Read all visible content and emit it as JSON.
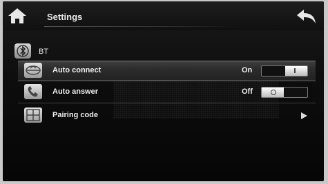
{
  "header": {
    "title": "Settings",
    "home_icon": "home-icon",
    "back_icon": "back-arrow-icon"
  },
  "section": {
    "label": "BT",
    "icon": "bluetooth-icon"
  },
  "rows": [
    {
      "label": "Auto connect",
      "value": "On",
      "icon": "auto-connect-icon",
      "toggle_on": true
    },
    {
      "label": "Auto answer",
      "value": "Off",
      "icon": "phone-answer-icon",
      "toggle_on": false
    },
    {
      "label": "Pairing code",
      "icon": "keypad-icon",
      "chevron_icon": "chevron-right-icon"
    }
  ],
  "colors": {
    "screen_bg": "#0d0d0d",
    "text": "#f0f0f0",
    "selected_row_bg": "#2c2c2c"
  }
}
